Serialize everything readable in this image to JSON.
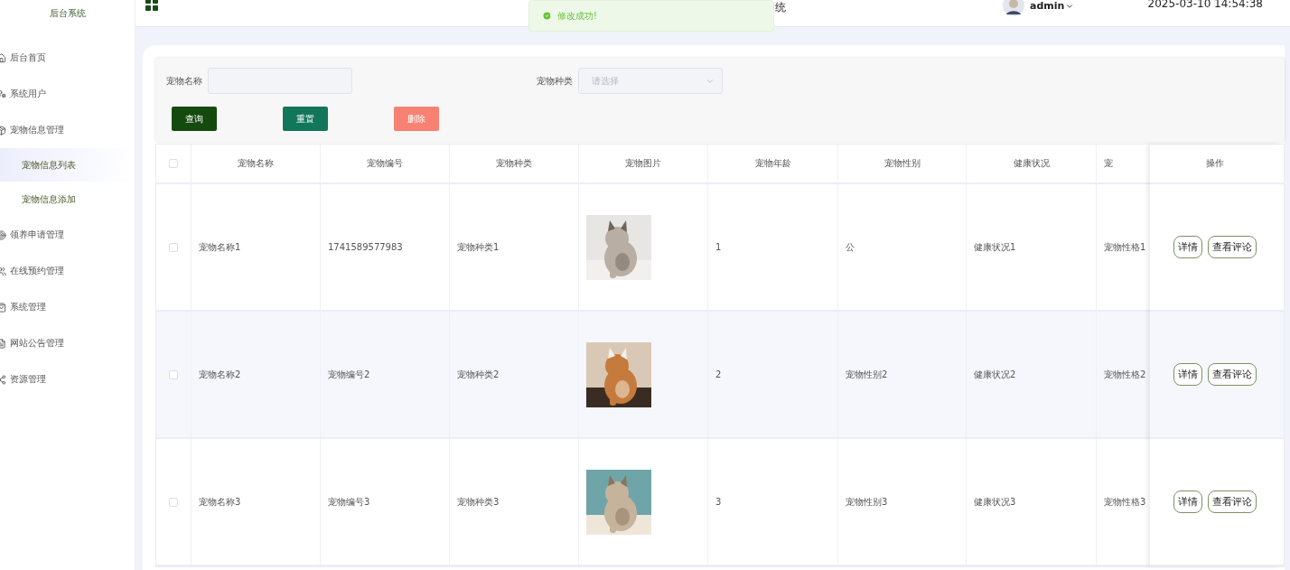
{
  "sidebar": {
    "title": "后台系统",
    "items": [
      {
        "label": "后台首页",
        "selected": false
      },
      {
        "label": "系统用户",
        "selected": false
      },
      {
        "label": "宠物信息管理",
        "selected": false,
        "children": [
          {
            "label": "宠物信息列表",
            "selected": true
          },
          {
            "label": "宠物信息添加",
            "selected": false
          }
        ]
      },
      {
        "label": "领养申请管理",
        "selected": false
      },
      {
        "label": "在线预约管理",
        "selected": false
      },
      {
        "label": "系统管理",
        "selected": false
      },
      {
        "label": "网站公告管理",
        "selected": false
      },
      {
        "label": "资源管理",
        "selected": false
      }
    ]
  },
  "header": {
    "title_fragment": "统",
    "user": "admin",
    "datetime": "2025-03-10 14:54:38"
  },
  "toast": {
    "message": "修改成功!"
  },
  "search": {
    "fields": [
      {
        "label": "宠物名称",
        "kind": "input"
      },
      {
        "label": "宠物种类",
        "kind": "select",
        "placeholder": "请选择"
      }
    ],
    "buttons": [
      {
        "label": "查询",
        "kind": "query"
      },
      {
        "label": "重置",
        "kind": "reset"
      },
      {
        "label": "删除",
        "kind": "delete"
      }
    ]
  },
  "table": {
    "all_checked": false,
    "columns": [
      "宠物名称",
      "宠物编号",
      "宠物种类",
      "宠物图片",
      "宠物年龄",
      "宠物性别",
      "健康状况",
      "宠"
    ],
    "actions_heading": "操作",
    "rows": [
      {
        "checked": false,
        "cells": [
          "宠物名称1",
          "1741589577983",
          "宠物种类1",
          {
            "kind": "picture"
          },
          "1",
          "公",
          "健康状况1",
          "宠物性格1"
        ],
        "actions": [
          "详情",
          "查看评论"
        ]
      },
      {
        "checked": false,
        "cells": [
          "宠物名称2",
          "宠物编号2",
          "宠物种类2",
          {
            "kind": "picture"
          },
          "2",
          "宠物性别2",
          "健康状况2",
          "宠物性格2"
        ],
        "actions": [
          "详情",
          "查看评论"
        ]
      },
      {
        "checked": false,
        "cells": [
          "宠物名称3",
          "宠物编号3",
          "宠物种类3",
          {
            "kind": "picture"
          },
          "3",
          "宠物性别3",
          "健康状况3",
          "宠物性格3"
        ],
        "actions": [
          "详情",
          "查看评论"
        ]
      }
    ]
  }
}
